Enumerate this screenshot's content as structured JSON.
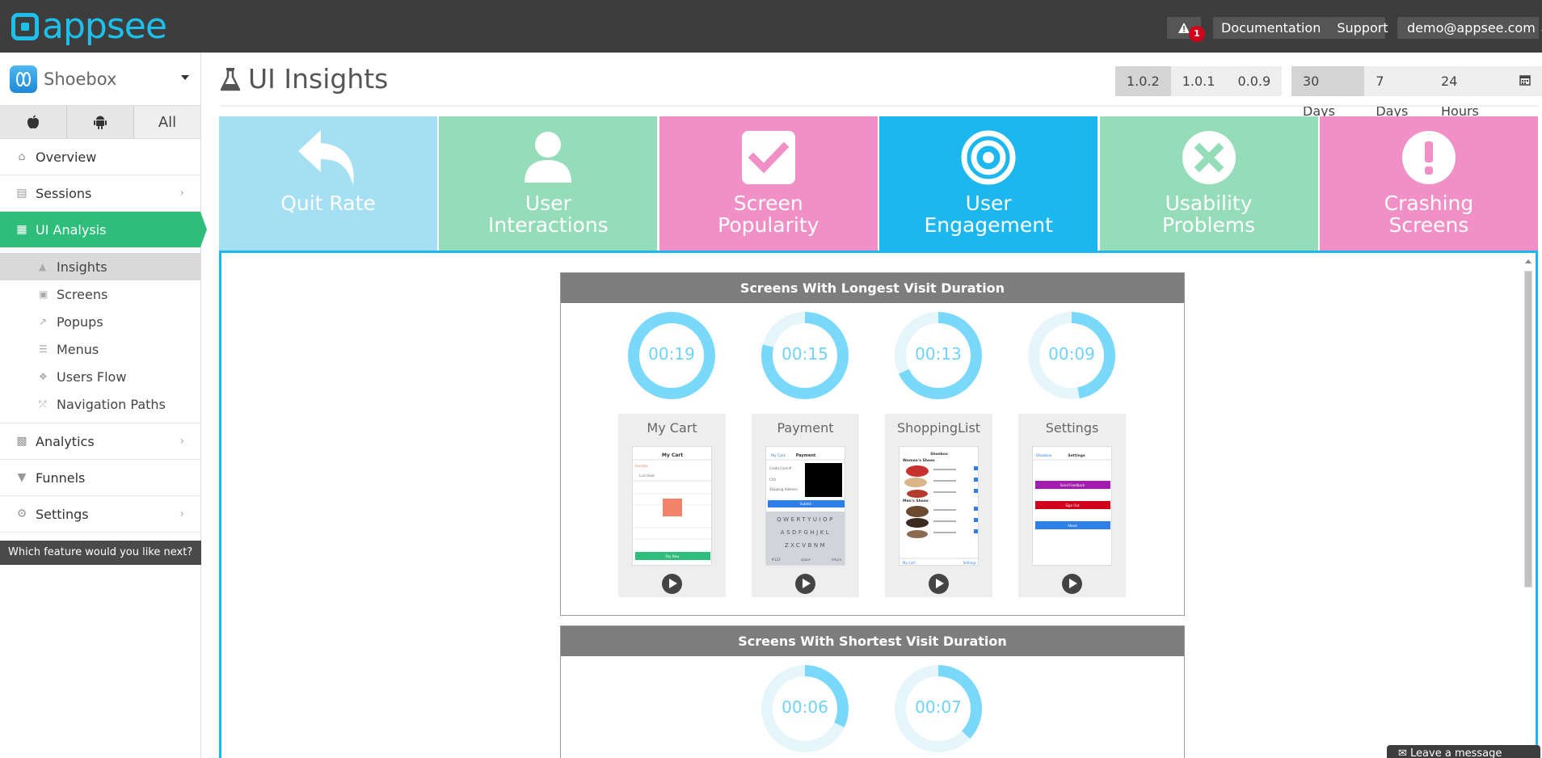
{
  "topbar": {
    "logo_text": "appsee",
    "alert_count": "1",
    "documentation": "Documentation",
    "support": "Support",
    "user": "demo@appsee.com"
  },
  "sidebar": {
    "app_name": "Shoebox",
    "platforms": [
      "",
      "",
      "All"
    ],
    "items": {
      "overview": "Overview",
      "sessions": "Sessions",
      "ui_analysis": "UI Analysis",
      "analytics": "Analytics",
      "funnels": "Funnels",
      "settings": "Settings"
    },
    "subitems": [
      "Insights",
      "Screens",
      "Popups",
      "Menus",
      "Users Flow",
      "Navigation Paths"
    ],
    "feature_prompt": "Which feature would you like next?"
  },
  "page": {
    "title": "UI Insights",
    "versions": [
      "1.0.2",
      "1.0.1",
      "0.0.9"
    ],
    "ranges": [
      "30 Days",
      "7 Days",
      "24 Hours"
    ]
  },
  "tiles": [
    {
      "line1": "Quit Rate",
      "line2": "",
      "color": "#a4dff4"
    },
    {
      "line1": "User",
      "line2": "Interactions",
      "color": "#95dcb9"
    },
    {
      "line1": "Screen",
      "line2": "Popularity",
      "color": "#f190c6"
    },
    {
      "line1": "User",
      "line2": "Engagement",
      "color": "#1cb7ef"
    },
    {
      "line1": "Usability",
      "line2": "Problems",
      "color": "#95dcb9"
    },
    {
      "line1": "Crashing",
      "line2": "Screens",
      "color": "#f190c6"
    }
  ],
  "longest": {
    "title": "Screens With Longest Visit Duration",
    "items": [
      {
        "time": "00:19",
        "fraction": 1.0,
        "screen": "My Cart"
      },
      {
        "time": "00:15",
        "fraction": 0.79,
        "screen": "Payment"
      },
      {
        "time": "00:13",
        "fraction": 0.68,
        "screen": "ShoppingList"
      },
      {
        "time": "00:09",
        "fraction": 0.47,
        "screen": "Settings"
      }
    ]
  },
  "shortest": {
    "title": "Screens With Shortest Visit Duration",
    "items": [
      {
        "time": "00:06",
        "fraction": 0.32
      },
      {
        "time": "00:07",
        "fraction": 0.37
      }
    ]
  },
  "thumbs": {
    "mycart": {
      "title": "My Cart",
      "sub": "Sandals",
      "row": "Luis Hawi",
      "btn": "Pay Now"
    },
    "payment": {
      "back": "My Cart",
      "title": "Payment",
      "rows": [
        "Credit Card #",
        "CVV",
        "Shipping Address"
      ],
      "submit": "Submit",
      "keys1": "QWERTYUIOP",
      "keys2": "ASDFGHJKL",
      "keys3": "ZXCVBNM",
      "bottom": [
        "#123",
        "space",
        "return"
      ]
    },
    "shopping": {
      "title": "Shoebox",
      "sec1": "Women's Shoes",
      "sec2": "Men's Shoes",
      "footer_left": "My Cart",
      "footer_right": "Settings"
    },
    "settings": {
      "back": "Shoebox",
      "title": "Settings",
      "b1": "Send Feedback",
      "b2": "Sign Out",
      "b3": "About"
    }
  },
  "message_tab": "Leave a message",
  "colors": {
    "accent_green": "#2fbd7c",
    "accent_blue": "#1cb7ef",
    "ring": "#7ad9fb",
    "ring_track": "#e6f5fb"
  }
}
